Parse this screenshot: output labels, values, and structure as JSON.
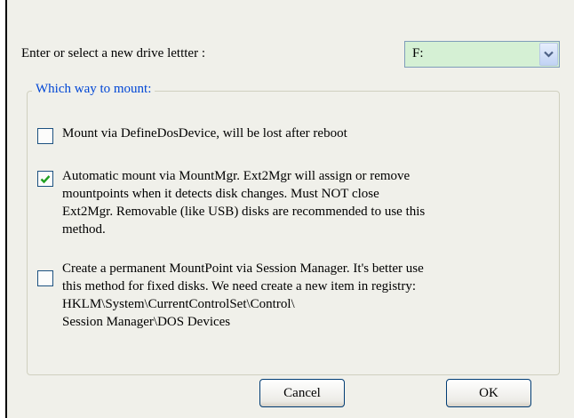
{
  "drive": {
    "label": "Enter or select a new drive lettter :",
    "selected_value": "F:",
    "arrow_icon": "chevron-down-icon",
    "field_color": "#d5f0d4"
  },
  "mount_group": {
    "legend": "Which way to mount:",
    "options": [
      {
        "checked": false,
        "label": "Mount via DefineDosDevice, will be lost after reboot"
      },
      {
        "checked": true,
        "label": "Automatic mount via MountMgr. Ext2Mgr will assign or remove\nmountpoints when it detects disk changes. Must NOT close\nExt2Mgr. Removable (like USB) disks are recommended to use this\nmethod."
      },
      {
        "checked": false,
        "label": "Create a permanent MountPoint via Session Manager. It's better use\nthis method for fixed disks. We need create a new item in registry:\nHKLM\\System\\CurrentControlSet\\Control\\\nSession Manager\\DOS Devices"
      }
    ]
  },
  "buttons": {
    "cancel_label": "Cancel",
    "ok_label": "OK"
  },
  "colors": {
    "accent": "#0046d5",
    "check": "#21a121",
    "dialog_bg": "#f0f0ea"
  }
}
